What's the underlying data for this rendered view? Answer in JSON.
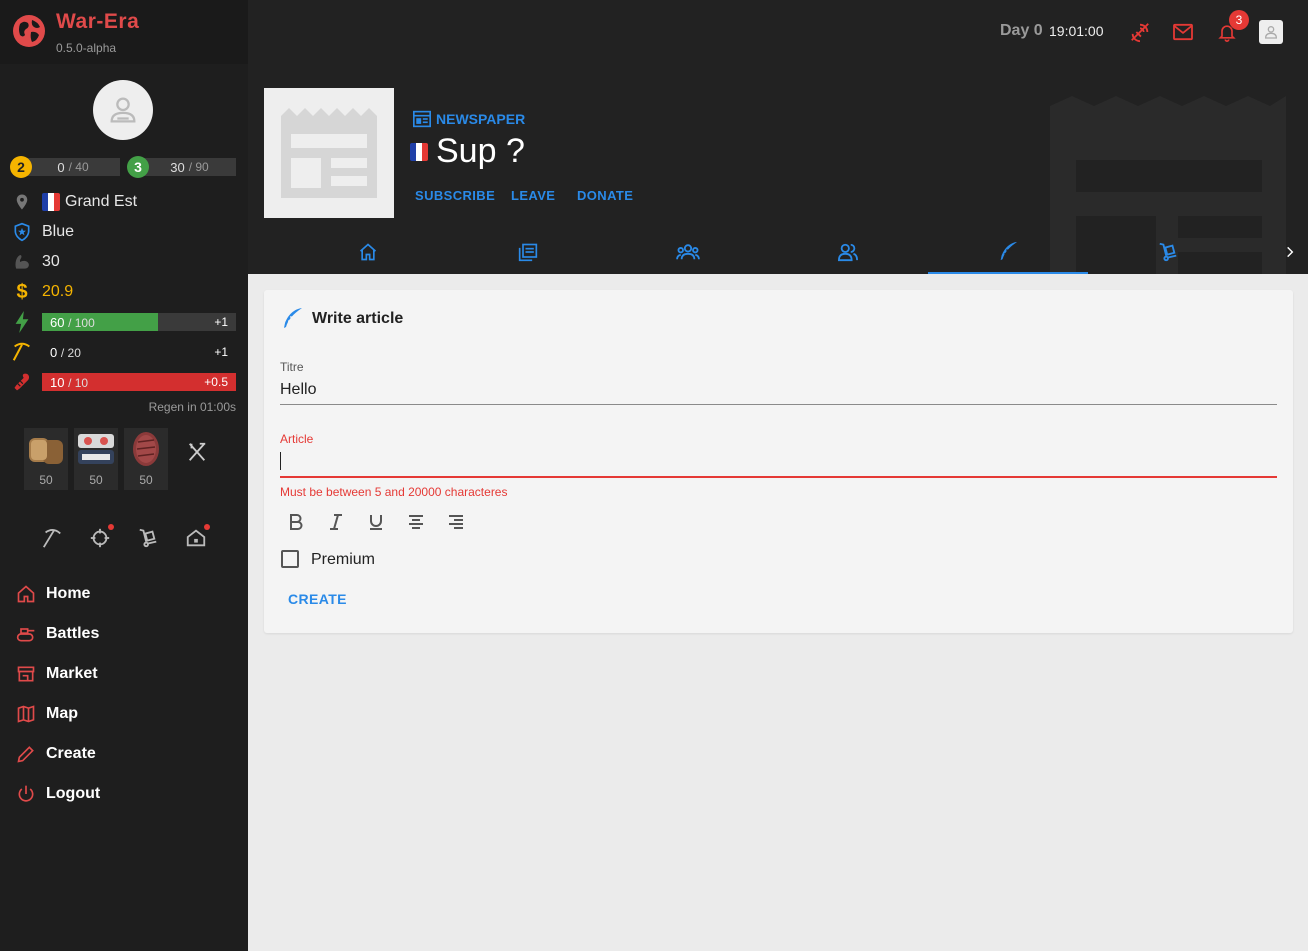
{
  "brand": {
    "name": "War-Era",
    "version": "0.5.0-alpha"
  },
  "levels": [
    {
      "level": "2",
      "current": "0",
      "max": "/ 40",
      "color": "#f5b400"
    },
    {
      "level": "3",
      "current": "30",
      "max": "/ 90",
      "color": "#43a047"
    }
  ],
  "profile": {
    "region": "Grand Est",
    "party": "Blue",
    "strength": "30",
    "money": "20.9",
    "energy": {
      "current": "60",
      "max": "/ 100",
      "delta": "+1",
      "fraction": 0.6
    },
    "work": {
      "current": "0",
      "max": "/ 20",
      "delta": "+1"
    },
    "health": {
      "current": "10",
      "max": "/ 10",
      "delta": "+0.5",
      "fraction": 1.0
    },
    "regen": "Regen in 01:00s"
  },
  "food": [
    {
      "item": "bread",
      "count": "50"
    },
    {
      "item": "sushi",
      "count": "50"
    },
    {
      "item": "steak",
      "count": "50"
    }
  ],
  "nav": [
    {
      "label": "Home",
      "icon": "home-icon"
    },
    {
      "label": "Battles",
      "icon": "tank-icon"
    },
    {
      "label": "Market",
      "icon": "store-icon"
    },
    {
      "label": "Map",
      "icon": "map-icon"
    },
    {
      "label": "Create",
      "icon": "pencil-icon"
    },
    {
      "label": "Logout",
      "icon": "power-icon"
    }
  ],
  "topbar": {
    "day": "Day 0",
    "time": "19:01:00",
    "notifications": "3"
  },
  "newspaper": {
    "kind": "NEWSPAPER",
    "title": "Sup ?",
    "buttons": [
      "SUBSCRIBE",
      "LEAVE",
      "DONATE"
    ],
    "active_tab": "write"
  },
  "form": {
    "heading": "Write article",
    "title_label": "Titre",
    "title_value": "Hello",
    "article_label": "Article",
    "article_error": "Must be between 5 and 20000 characteres",
    "premium_label": "Premium",
    "create_label": "CREATE"
  },
  "colors": {
    "accent": "#2a8ae8",
    "brand": "#e04a4a",
    "error": "#e53935",
    "energy": "#43a047",
    "health": "#d32f2f"
  }
}
